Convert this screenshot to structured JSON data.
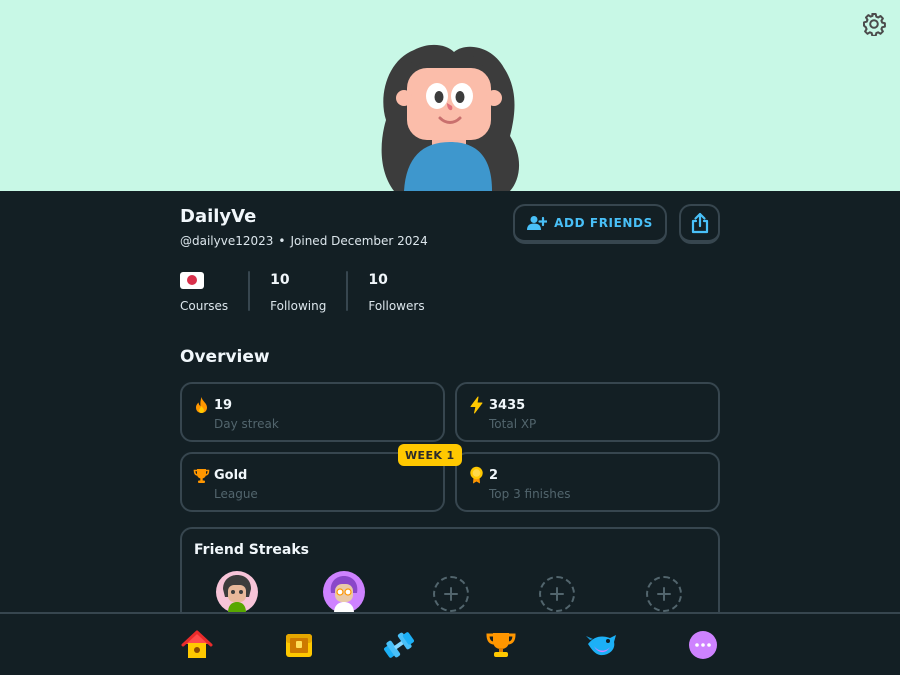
{
  "profile": {
    "name": "DailyVe",
    "handle": "@dailyve12023",
    "joined": "Joined December 2024",
    "separator": "•"
  },
  "actions": {
    "add_friends": "ADD FRIENDS",
    "share_icon": "share-icon"
  },
  "stats": {
    "courses_label": "Courses",
    "courses_flag": "japan-flag",
    "following_value": "10",
    "following_label": "Following",
    "followers_value": "10",
    "followers_label": "Followers"
  },
  "overview": {
    "title": "Overview",
    "cards": [
      {
        "icon": "fire-icon",
        "value": "19",
        "label": "Day streak"
      },
      {
        "icon": "lightning-icon",
        "value": "3435",
        "label": "Total XP"
      },
      {
        "icon": "trophy-icon",
        "value": "Gold",
        "label": "League",
        "badge": "WEEK 1"
      },
      {
        "icon": "medal-icon",
        "value": "2",
        "label": "Top 3 finishes"
      }
    ]
  },
  "friend_streaks": {
    "title": "Friend Streaks",
    "slots": [
      "friend-avatar",
      "friend-avatar",
      "add-friend",
      "add-friend",
      "add-friend"
    ]
  },
  "nav": {
    "items": [
      "home-icon",
      "chest-icon",
      "dumbbell-icon",
      "trophy-icon",
      "bird-icon",
      "more-icon"
    ]
  },
  "colors": {
    "banner": "#c8f8e6",
    "background": "#131f24",
    "border": "#37464f",
    "accent_blue": "#49c0f8",
    "badge_yellow": "#ffc800"
  }
}
